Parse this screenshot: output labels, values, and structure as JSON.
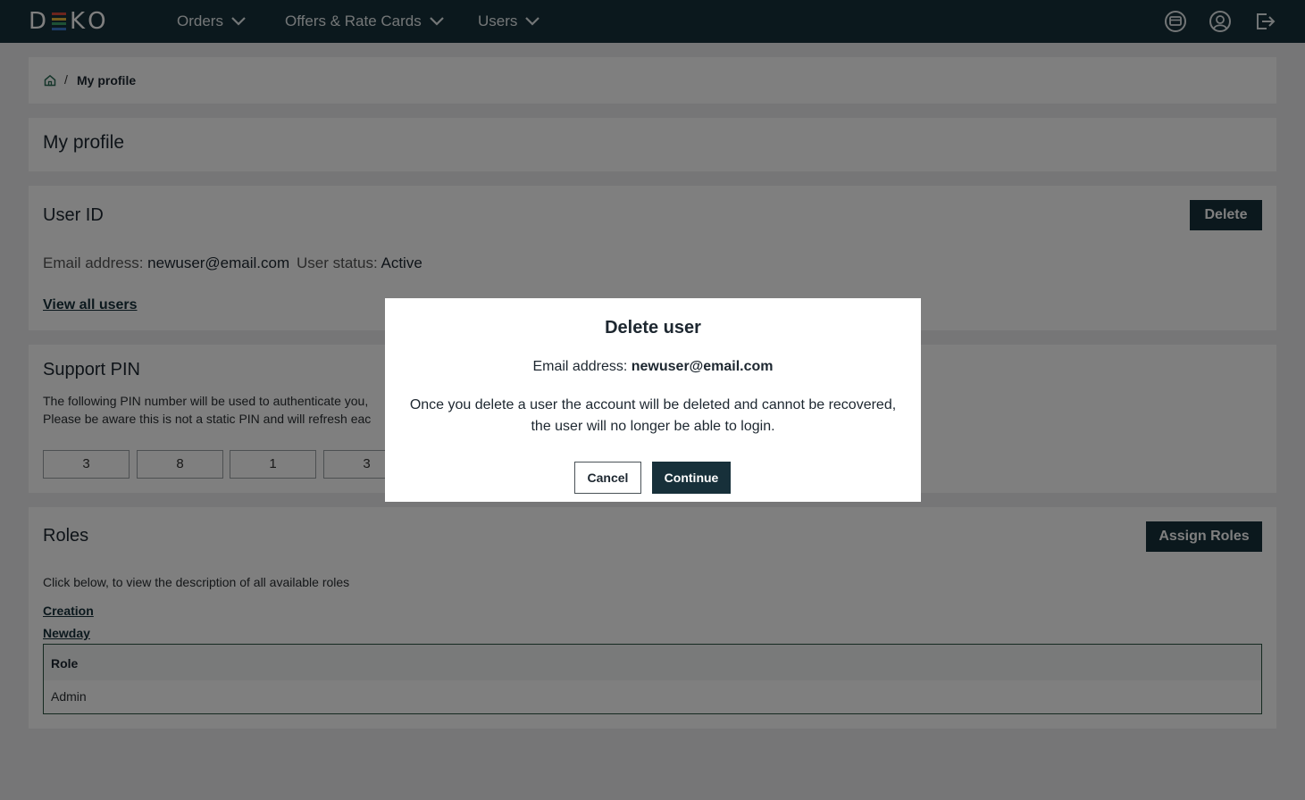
{
  "nav": {
    "logo": [
      "D",
      "K",
      "O"
    ],
    "logo_colors": [
      "#d9483b",
      "#e8b83a",
      "#3aa36b",
      "#3b7bd1"
    ],
    "items": [
      {
        "label": "Orders"
      },
      {
        "label": "Offers & Rate Cards"
      },
      {
        "label": "Users"
      }
    ],
    "icons": [
      "support-chat-icon",
      "account-icon",
      "logout-icon"
    ]
  },
  "breadcrumb": {
    "home_icon": "home-icon",
    "separator": "/",
    "current": "My profile"
  },
  "page": {
    "title": "My profile"
  },
  "user_id": {
    "heading": "User ID",
    "delete_label": "Delete",
    "email_label": "Email address:",
    "email_value": "newuser@email.com",
    "status_label": "User status:",
    "status_value": "Active",
    "view_all_link": "View all users"
  },
  "support_pin": {
    "heading": "Support PIN",
    "line1": "The following PIN number will be used to authenticate you,",
    "line2": "Please be aware this is not a static PIN and will refresh eac",
    "digits": [
      "3",
      "8",
      "1",
      "3"
    ]
  },
  "roles": {
    "heading": "Roles",
    "assign_label": "Assign Roles",
    "description": "Click below, to view the description of all available roles",
    "links": [
      "Creation",
      "Newday"
    ],
    "table_header": "Role",
    "rows": [
      "Admin"
    ]
  },
  "modal": {
    "title": "Delete user",
    "email_label": "Email address:",
    "email_value": "newuser@email.com",
    "message_line1": "Once you delete a user the account will be deleted and cannot be recovered,",
    "message_line2": "the user will no longer be able to login.",
    "cancel_label": "Cancel",
    "continue_label": "Continue"
  },
  "colors": {
    "nav_bg": "#17303a",
    "primary_button": "#17303a",
    "overlay": "rgba(0,0,0,0.5)"
  }
}
